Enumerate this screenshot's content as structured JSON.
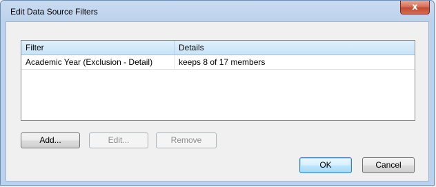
{
  "window": {
    "title": "Edit Data Source Filters",
    "close_glyph": "x"
  },
  "grid": {
    "columns": [
      "Filter",
      "Details"
    ],
    "rows": [
      {
        "filter": "Academic Year (Exclusion - Detail)",
        "details": "keeps 8 of 17 members"
      }
    ]
  },
  "buttons": {
    "add": "Add...",
    "edit": "Edit...",
    "remove": "Remove",
    "ok": "OK",
    "cancel": "Cancel"
  },
  "colors": {
    "header_gradient_top": "#dff0fb",
    "close_button": "#c24a33",
    "default_button_border": "#3c7fb1"
  }
}
